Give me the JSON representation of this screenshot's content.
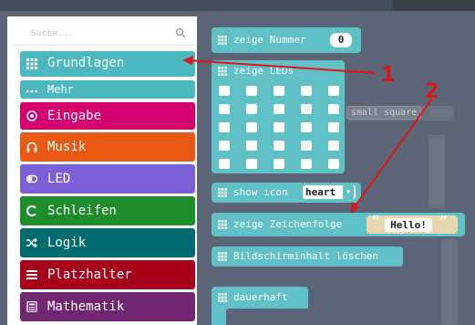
{
  "search": {
    "placeholder": "Suche..."
  },
  "toolbox": {
    "categories": [
      {
        "label": "Grundlagen",
        "icon": "grid-icon",
        "color": "#4bb8bf"
      },
      {
        "label": "Mehr",
        "icon": "more-dots-icon",
        "color": "#4bb8bf"
      },
      {
        "label": "Eingabe",
        "icon": "target-icon",
        "color": "#d4006e"
      },
      {
        "label": "Musik",
        "icon": "headphones-icon",
        "color": "#e85a14"
      },
      {
        "label": "LED",
        "icon": "toggle-icon",
        "color": "#7b5fd6"
      },
      {
        "label": "Schleifen",
        "icon": "loop-icon",
        "color": "#1d8c2b"
      },
      {
        "label": "Logik",
        "icon": "shuffle-icon",
        "color": "#006c70"
      },
      {
        "label": "Platzhalter",
        "icon": "list-icon",
        "color": "#a8001a"
      },
      {
        "label": "Mathematik",
        "icon": "calculator-icon",
        "color": "#712672"
      }
    ]
  },
  "blocks": {
    "show_number": {
      "label": "zeige Nummer",
      "value": "0"
    },
    "show_leds": {
      "label": "zeige LEDs"
    },
    "show_icon": {
      "label": "show icon",
      "value": "heart"
    },
    "show_string": {
      "label": "zeige Zeichenfolge",
      "value": "Hello!",
      "quote_open": "“",
      "quote_close": "”"
    },
    "clear_screen": {
      "label": "Bildschirminhalt löschen"
    },
    "forever": {
      "label": "dauerhaft"
    }
  },
  "background_chip": {
    "label": "small square"
  },
  "annotations": {
    "one": "1",
    "two": "2"
  },
  "colors": {
    "workspace": "#5c6477",
    "basic_block": "#5fc0c5",
    "annotation": "#e01414"
  }
}
